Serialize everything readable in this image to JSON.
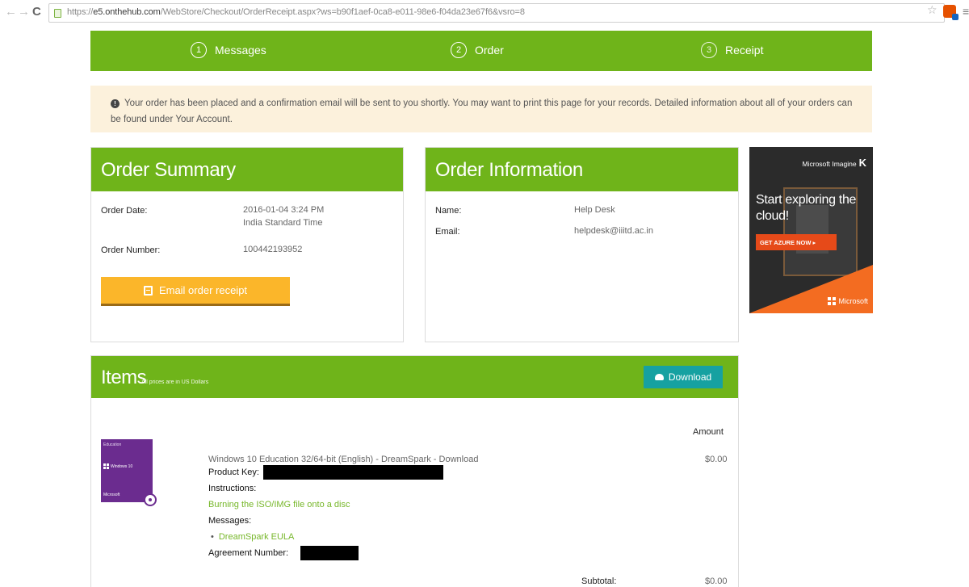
{
  "browser": {
    "url_scheme": "https://",
    "url_host": "e5.onthehub.com",
    "url_path": "/WebStore/Checkout/OrderReceipt.aspx?ws=b90f1aef-0ca8-e011-98e6-f04da23e67f6&vsro=8",
    "back_glyph": "←",
    "forward_glyph": "→",
    "reload_glyph": "C",
    "star_glyph": "☆",
    "menu_glyph": "≡"
  },
  "steps": [
    {
      "num": "1",
      "label": "Messages"
    },
    {
      "num": "2",
      "label": "Order"
    },
    {
      "num": "3",
      "label": "Receipt"
    }
  ],
  "notice": {
    "text": "Your order has been placed and a confirmation email will be sent to you shortly. You may want to print this page for your records. Detailed information about all of your orders can be found under Your Account."
  },
  "order_summary": {
    "title": "Order Summary",
    "date_label": "Order Date:",
    "date_value": "2016-01-04 3:24 PM",
    "timezone": "India Standard Time",
    "number_label": "Order Number:",
    "number_value": "100442193952",
    "email_button_label": "Email order receipt"
  },
  "order_info": {
    "title": "Order Information",
    "name_label": "Name:",
    "name_value": "Help Desk",
    "email_label": "Email:",
    "email_value": "helpdesk@iiitd.ac.in"
  },
  "ad": {
    "brand": "Microsoft Imagine",
    "brand_mark": "K",
    "headline": "Start exploring the cloud!",
    "cta": "GET AZURE NOW ▸",
    "footer": "Microsoft"
  },
  "items": {
    "title": "Items",
    "note": "All prices are in US Dollars",
    "download_label": "Download",
    "amount_header": "Amount",
    "product": {
      "box_label": "Education",
      "box_windows": "Windows 10",
      "box_ms": "Microsoft",
      "name": "Windows 10 Education 32/64-bit (English) - DreamSpark - Download",
      "price": "$0.00",
      "product_key_label": "Product Key:",
      "instructions_label": "Instructions:",
      "instructions_link": "Burning the ISO/IMG file onto a disc",
      "messages_label": "Messages:",
      "messages_link": "DreamSpark EULA",
      "agreement_label": "Agreement Number:"
    },
    "subtotal_label": "Subtotal:",
    "subtotal_value": "$0.00"
  }
}
